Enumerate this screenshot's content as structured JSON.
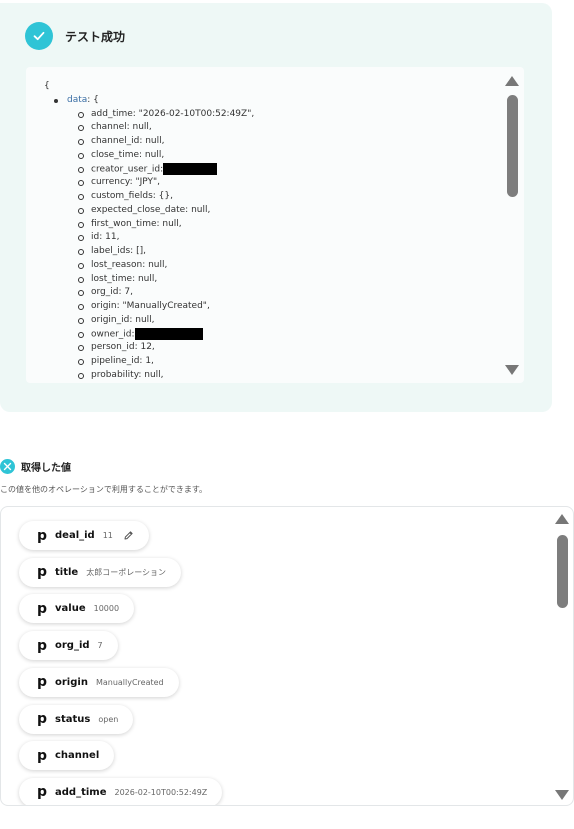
{
  "result": {
    "title": "テスト成功",
    "json_open": "{",
    "data_key": "data",
    "data_suffix": ": {",
    "fields": [
      {
        "key": "add_time",
        "value": ": \"2026-02-10T00:52:49Z\","
      },
      {
        "key": "channel",
        "value": ": null,"
      },
      {
        "key": "channel_id",
        "value": ": null,"
      },
      {
        "key": "close_time",
        "value": ": null,"
      },
      {
        "key": "creator_user_id",
        "value": ":",
        "redacted": true
      },
      {
        "key": "currency",
        "value": ": \"JPY\","
      },
      {
        "key": "custom_fields",
        "value": ": {},"
      },
      {
        "key": "expected_close_date",
        "value": ": null,"
      },
      {
        "key": "first_won_time",
        "value": ": null,"
      },
      {
        "key": "id",
        "value": ": 11,"
      },
      {
        "key": "label_ids",
        "value": ": [],"
      },
      {
        "key": "lost_reason",
        "value": ": null,"
      },
      {
        "key": "lost_time",
        "value": ": null,"
      },
      {
        "key": "org_id",
        "value": ": 7,"
      },
      {
        "key": "origin",
        "value": ": \"ManuallyCreated\","
      },
      {
        "key": "origin_id",
        "value": ": null,"
      },
      {
        "key": "owner_id",
        "value": ":",
        "redacted": true
      },
      {
        "key": "person_id",
        "value": ": 12,"
      },
      {
        "key": "pipeline_id",
        "value": ": 1,"
      },
      {
        "key": "probability",
        "value": ": null,"
      }
    ]
  },
  "values": {
    "title": "取得した値",
    "description": "この値を他のオペレーションで利用することができます。",
    "items": [
      {
        "icon": "p",
        "name": "deal_id",
        "value": "11",
        "editable": true
      },
      {
        "icon": "p",
        "name": "title",
        "value": "太郎コーポレーション"
      },
      {
        "icon": "p",
        "name": "value",
        "value": "10000"
      },
      {
        "icon": "p",
        "name": "org_id",
        "value": "7"
      },
      {
        "icon": "p",
        "name": "origin",
        "value": "ManuallyCreated"
      },
      {
        "icon": "p",
        "name": "status",
        "value": "open"
      },
      {
        "icon": "p",
        "name": "channel",
        "value": ""
      },
      {
        "icon": "p",
        "name": "add_time",
        "value": "2026-02-10T00:52:49Z"
      }
    ]
  },
  "colors": {
    "accent": "#2fc4d6",
    "panel_bg": "#eef8f6"
  },
  "icons": {
    "status": "check-icon",
    "values": "sparkle-icon",
    "edit": "pencil-icon"
  }
}
